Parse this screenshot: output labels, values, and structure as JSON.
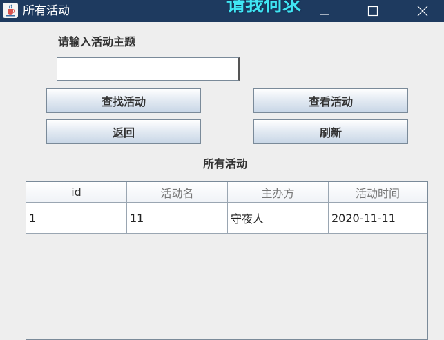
{
  "window": {
    "title": "所有活动",
    "overlay_text": "请我何求",
    "icons": {
      "app": "java-cup-icon",
      "minimize": "minimize-icon",
      "maximize": "maximize-icon",
      "close": "close-icon"
    }
  },
  "form": {
    "prompt_label": "请输入活动主题",
    "search_value": "",
    "buttons": {
      "find": "查找活动",
      "view": "查看活动",
      "back": "返回",
      "refresh": "刷新"
    }
  },
  "table": {
    "title": "所有活动",
    "columns": [
      "id",
      "活动名",
      "主办方",
      "活动时间"
    ],
    "rows": [
      [
        "1",
        "11",
        "守夜人",
        "2020-11-11"
      ]
    ]
  },
  "colors": {
    "titlebar": "#1e3a5f",
    "overlay_text": "#40e6f4",
    "background": "#eeeeee"
  }
}
